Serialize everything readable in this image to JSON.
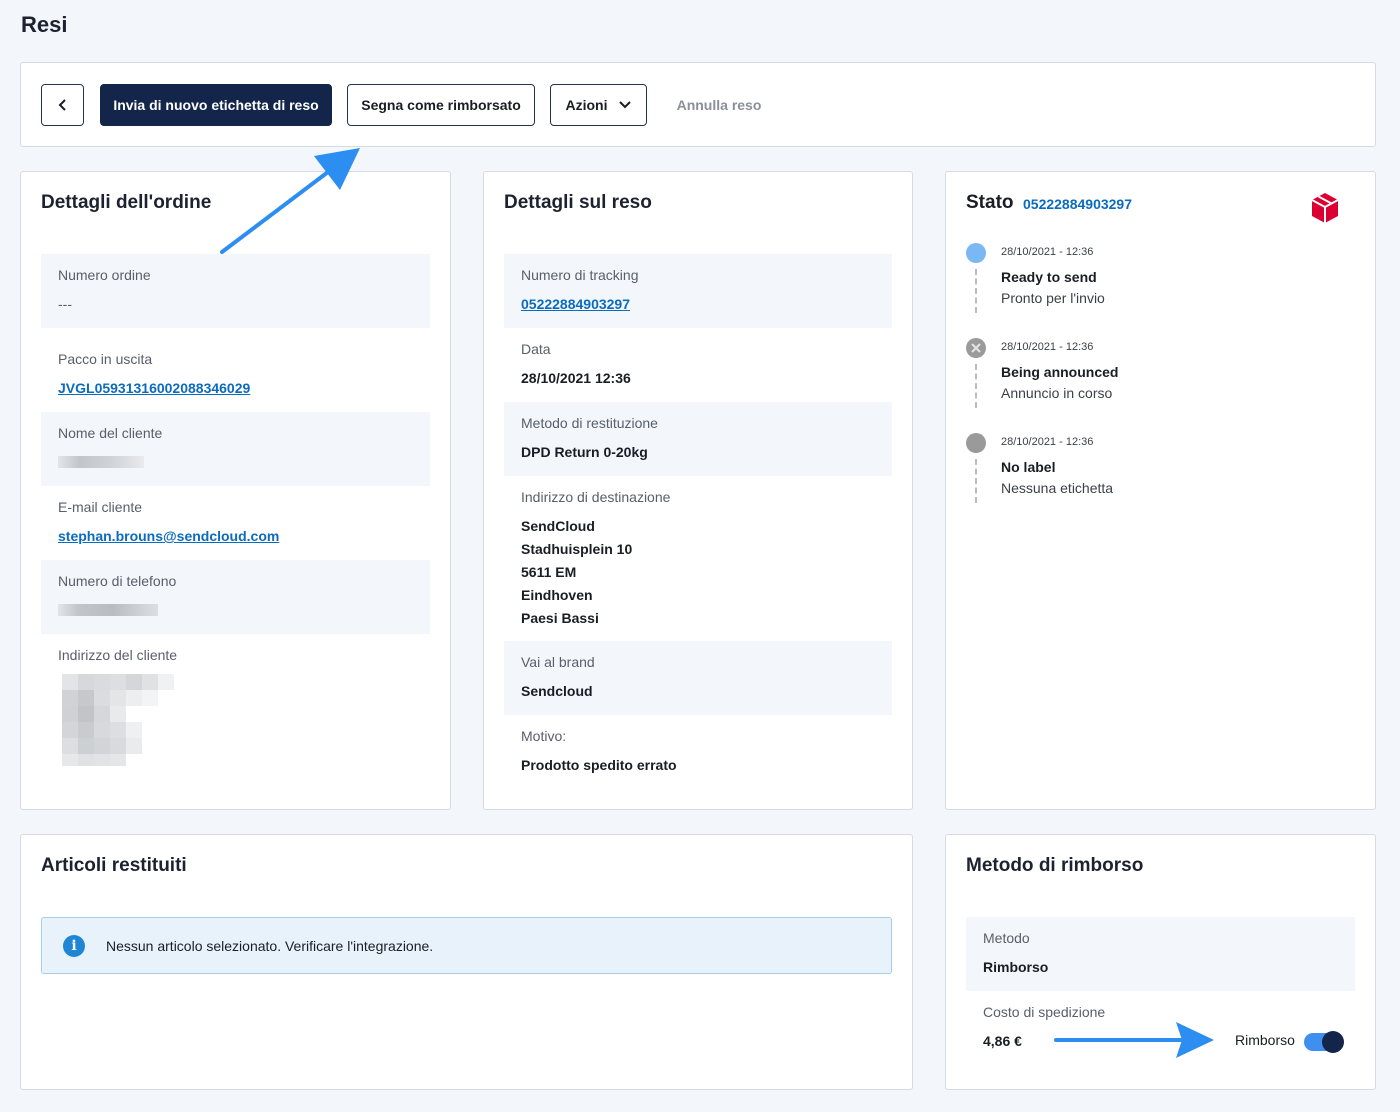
{
  "page_title": "Resi",
  "toolbar": {
    "resend_label": "Invia di nuovo etichetta di reso",
    "refunded_label": "Segna come rimborsato",
    "actions_label": "Azioni",
    "cancel_label": "Annulla reso"
  },
  "order": {
    "title": "Dettagli dell'ordine",
    "order_number_label": "Numero ordine",
    "order_number_value": "---",
    "outgoing_label": "Pacco in uscita",
    "outgoing_value": "JVGL05931316002088346029",
    "customer_name_label": "Nome del cliente",
    "email_label": "E-mail cliente",
    "email_value": "stephan.brouns@sendcloud.com",
    "phone_label": "Numero di telefono",
    "address_label": "Indirizzo del cliente"
  },
  "return": {
    "title": "Dettagli sul reso",
    "tracking_label": "Numero di tracking",
    "tracking_value": "05222884903297",
    "date_label": "Data",
    "date_value": "28/10/2021 12:36",
    "method_label": "Metodo di restituzione",
    "method_value": "DPD Return 0-20kg",
    "dest_label": "Indirizzo di destinazione",
    "dest_lines": [
      "SendCloud",
      "Stadhuisplein 10",
      "5611 EM",
      "Eindhoven",
      "Paesi Bassi"
    ],
    "brand_label": "Vai al brand",
    "brand_value": "Sendcloud",
    "reason_label": "Motivo:",
    "reason_value": "Prodotto spedito errato"
  },
  "status": {
    "title": "Stato",
    "tracking": "05222884903297",
    "events": [
      {
        "date": "28/10/2021 - 12:36",
        "title": "Ready to send",
        "subtitle": "Pronto per l'invio",
        "color": "#7ab8f5"
      },
      {
        "date": "28/10/2021 - 12:36",
        "title": "Being announced",
        "subtitle": "Annuncio in corso",
        "color": "#9a9a9a"
      },
      {
        "date": "28/10/2021 - 12:36",
        "title": "No label",
        "subtitle": "Nessuna etichetta",
        "color": "#9a9a9a"
      }
    ]
  },
  "items": {
    "title": "Articoli restituiti",
    "alert_text": "Nessun articolo selezionato. Verificare l'integrazione."
  },
  "refund": {
    "title": "Metodo di rimborso",
    "method_label": "Metodo",
    "method_value": "Rimborso",
    "cost_label": "Costo di spedizione",
    "cost_value": "4,86 €",
    "toggle_label": "Rimborso",
    "toggle_on": true
  },
  "colors": {
    "primary": "#13254a",
    "link": "#0b6bbf",
    "annotation_arrow": "#2b8ef0",
    "dpd_red": "#dc0032"
  }
}
